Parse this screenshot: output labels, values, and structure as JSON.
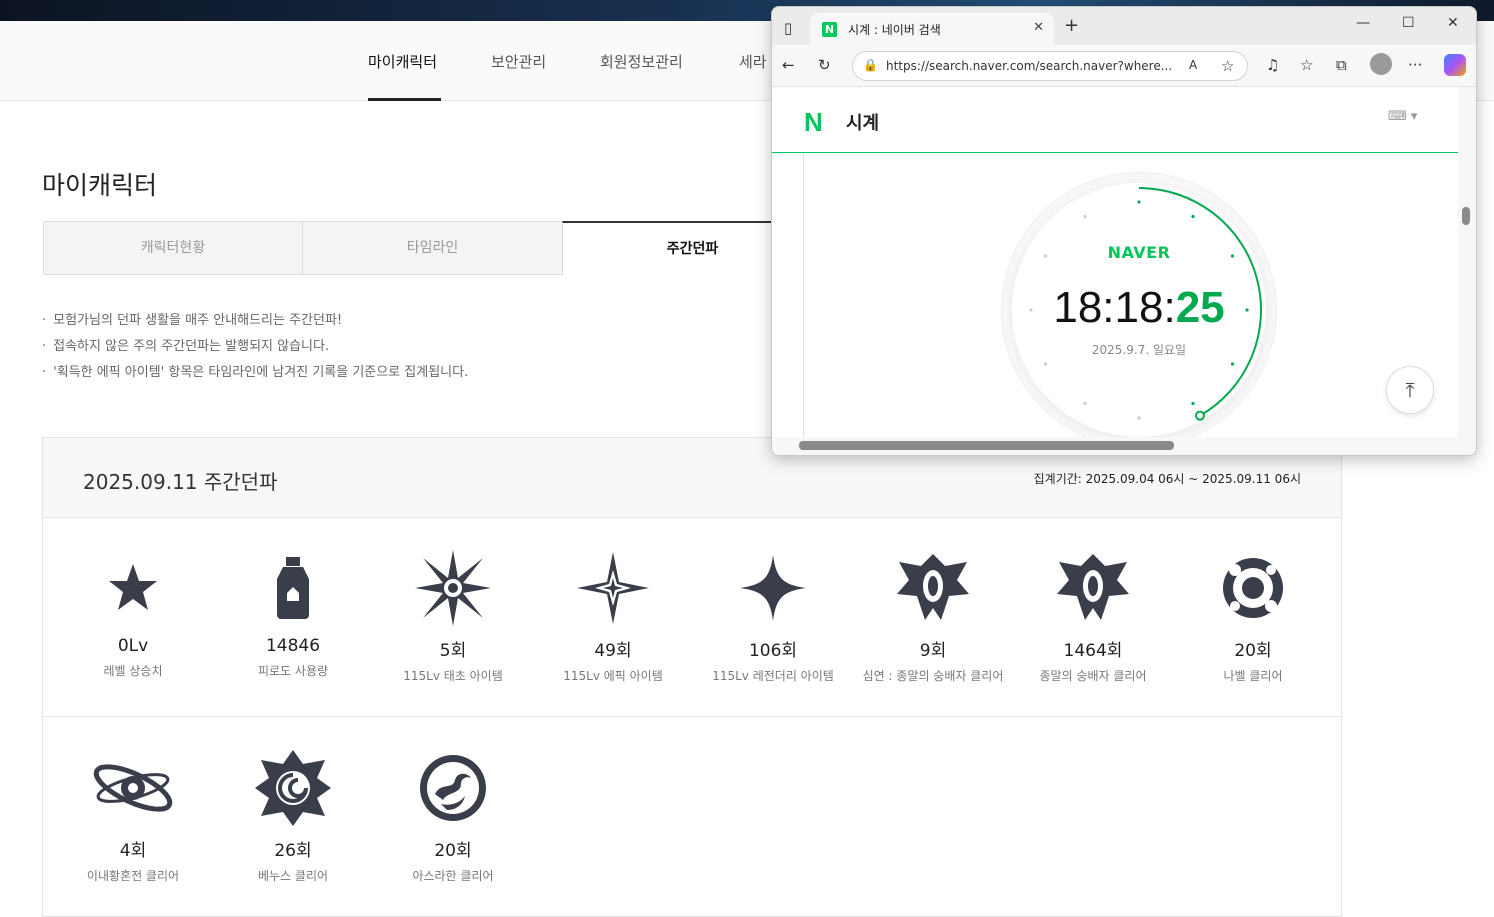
{
  "gnb": {
    "tabs": [
      "마이캐릭터",
      "보안관리",
      "회원정보관리",
      "세라"
    ]
  },
  "page": {
    "title": "마이캐릭터"
  },
  "subtabs": [
    "캐릭터현황",
    "타임라인",
    "주간던파"
  ],
  "notes": [
    "모험가님의 던파 생활을 매주 안내해드리는 주간던파!",
    "접속하지 않은 주의 주간던파는 발행되지 않습니다.",
    "'획득한 에픽 아이템' 항목은 타임라인에 남겨진 기록을 기준으로 집계됩니다."
  ],
  "weekly": {
    "title": "2025.09.11 주간던파",
    "period": "집계기간: 2025.09.04 06시 ~ 2025.09.11 06시",
    "items": [
      {
        "value": "0Lv",
        "label": "레벨 상승치",
        "icon": "star-icon"
      },
      {
        "value": "14846",
        "label": "피로도 사용량",
        "icon": "potion-icon"
      },
      {
        "value": "5회",
        "label": "115Lv 태초 아이템",
        "icon": "burst-icon"
      },
      {
        "value": "49회",
        "label": "115Lv 에픽 아이템",
        "icon": "sparkle-icon"
      },
      {
        "value": "106회",
        "label": "115Lv 레전더리 아이템",
        "icon": "four-point-star-icon"
      },
      {
        "value": "9회",
        "label": "심연 : 종말의 숭배자 클리어",
        "icon": "abyss-emblem-icon"
      },
      {
        "value": "1464회",
        "label": "종말의 숭배자 클리어",
        "icon": "cult-emblem-icon"
      },
      {
        "value": "20회",
        "label": "나벨 클리어",
        "icon": "nabel-emblem-icon"
      },
      {
        "value": "4회",
        "label": "이내황혼전 클리어",
        "icon": "orbit-emblem-icon"
      },
      {
        "value": "26회",
        "label": "베누스 클리어",
        "icon": "venus-emblem-icon"
      },
      {
        "value": "20회",
        "label": "아스라한 클리어",
        "icon": "asrahan-emblem-icon"
      }
    ]
  },
  "browser": {
    "tab_title": "시계 : 네이버 검색",
    "url": "https://search.naver.com/search.naver?where...",
    "query": "시계",
    "brand": "NAVER",
    "time_hm": "18:18:",
    "time_s": "25",
    "date": "2025.9.7.  일요일",
    "favicon": "N",
    "logo": "N",
    "seconds_fraction": 0.4167
  }
}
